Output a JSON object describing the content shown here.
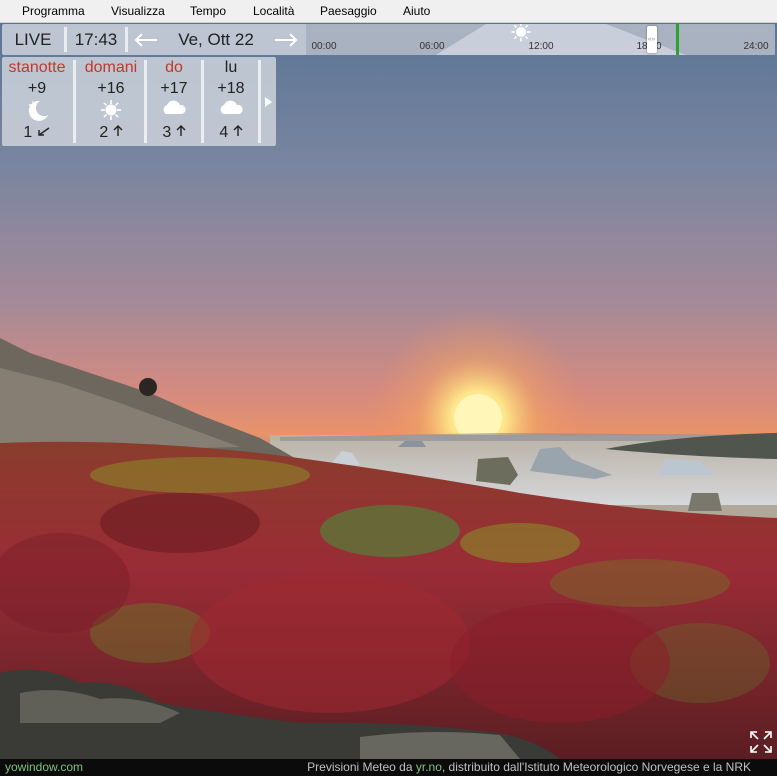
{
  "menu": {
    "items": [
      "Programma",
      "Visualizza",
      "Tempo",
      "Località",
      "Paesaggio",
      "Aiuto"
    ]
  },
  "timebar": {
    "live_label": "LIVE",
    "current_time": "17:43",
    "date_label": "Ve, Ott 22",
    "tick_labels": [
      "00:00",
      "06:00",
      "12:00",
      "18:00",
      "24:00"
    ],
    "selected_time_fraction": 0.737,
    "now_marker_fraction": 0.79
  },
  "forecast": {
    "days": [
      {
        "name": "stanotte",
        "temp": "+9",
        "icon": "moon-icon",
        "wind": "1",
        "wind_icon": "wind-arrow-southwest-icon"
      },
      {
        "name": "domani",
        "temp": "+16",
        "icon": "sun-icon",
        "wind": "2",
        "wind_icon": "wind-arrow-north-icon"
      },
      {
        "name": "do",
        "temp": "+17",
        "icon": "cloud-icon",
        "wind": "3",
        "wind_icon": "wind-arrow-north-icon"
      },
      {
        "name": "lu",
        "temp": "+18",
        "icon": "cloud-icon",
        "wind": "4",
        "wind_icon": "wind-arrow-north-icon"
      }
    ],
    "next_icon": "play-arrow-icon"
  },
  "footer": {
    "brand": "yowindow.com",
    "credit_prefix": "Previsioni Meteo da",
    "credit_link": "yr.no",
    "credit_suffix": ", distribuito dall'Istituto Meteorologico Norvegese e la NRK"
  },
  "colors": {
    "day_name": "#c0392b",
    "now_marker": "#2ea02e",
    "footer_link": "#7fc07f"
  }
}
